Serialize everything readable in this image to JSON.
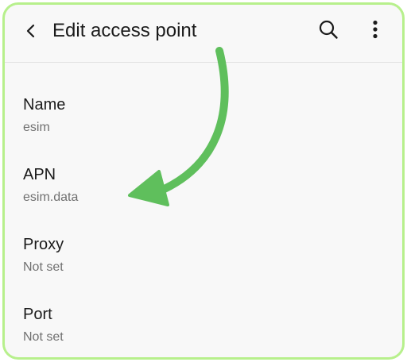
{
  "header": {
    "title": "Edit access point",
    "back_icon": "chevron-left-icon",
    "search_icon": "search-icon",
    "more_icon": "more-vertical-icon"
  },
  "settings": [
    {
      "label": "Name",
      "value": "esim"
    },
    {
      "label": "APN",
      "value": "esim.data"
    },
    {
      "label": "Proxy",
      "value": "Not set"
    },
    {
      "label": "Port",
      "value": "Not set"
    }
  ],
  "annotation": {
    "arrow_color": "#5fbf5c",
    "frame_color": "#b7f08c"
  }
}
